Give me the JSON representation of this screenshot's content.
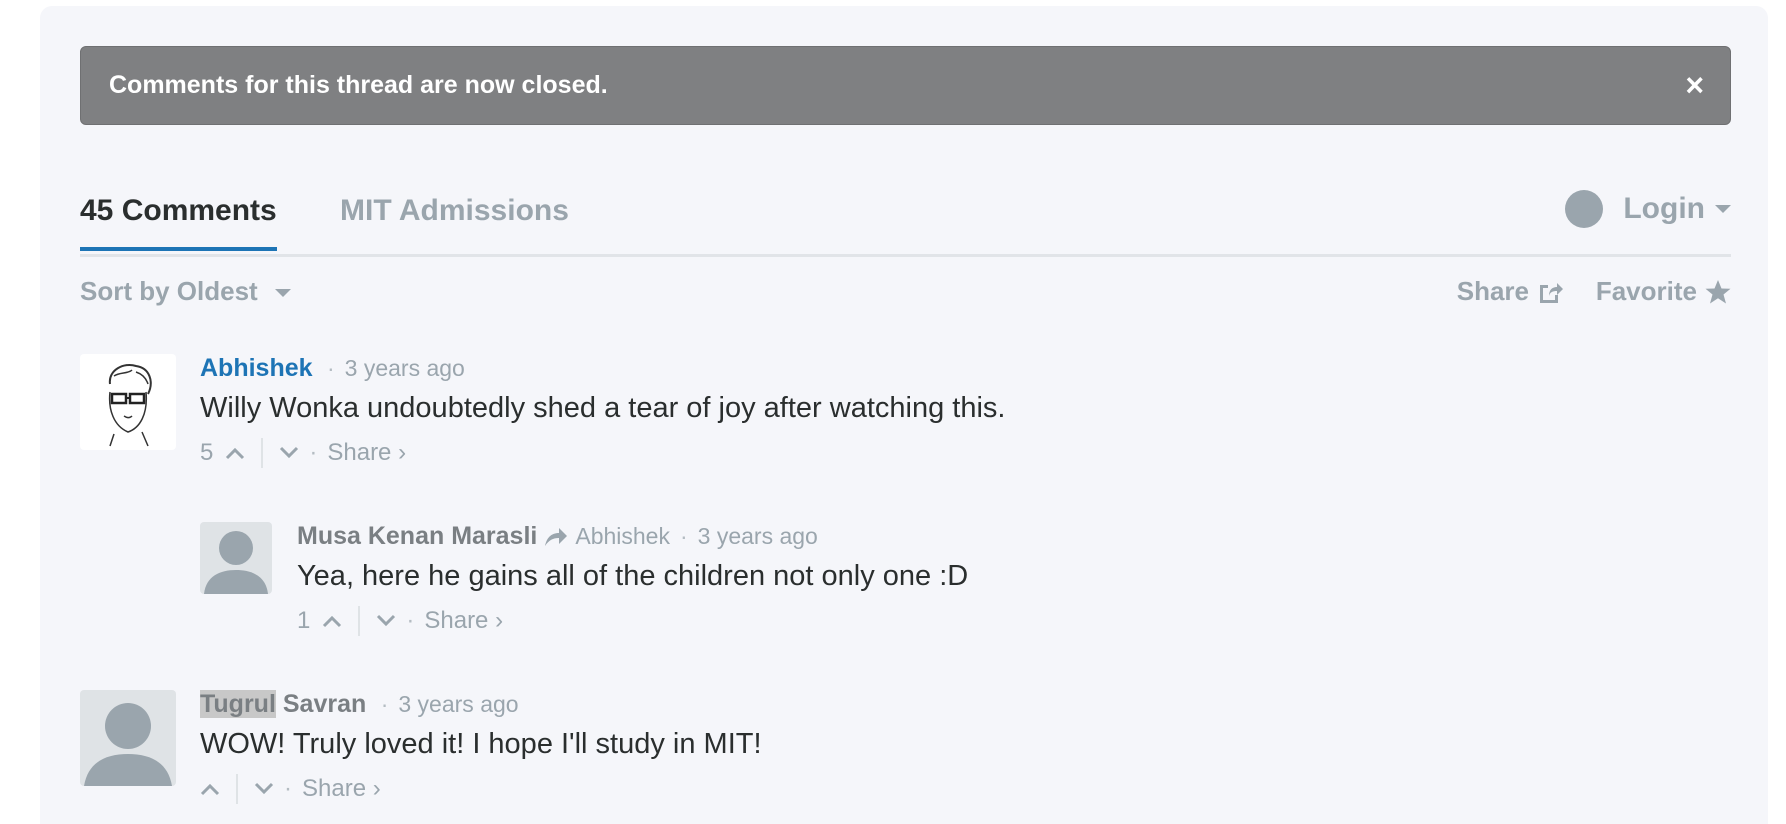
{
  "banner": {
    "text": "Comments for this thread are now closed.",
    "close": "×"
  },
  "tabs": {
    "comments": "45 Comments",
    "site": "MIT Admissions"
  },
  "login": {
    "label": "Login"
  },
  "toolbar": {
    "sort": "Sort by Oldest",
    "share": "Share",
    "favorite": "Favorite"
  },
  "comments": [
    {
      "author": "Abhishek",
      "time": "3 years ago",
      "text": "Willy Wonka undoubtedly shed a tear of joy after watching this.",
      "votes": "5",
      "share": "Share ›",
      "author_color": "#1d74b5"
    },
    {
      "author": "Musa Kenan Marasli",
      "reply_to": "Abhishek",
      "time": "3 years ago",
      "text": "Yea, here he gains all of the children not only one :D",
      "votes": "1",
      "share": "Share ›"
    },
    {
      "author_first": "Tugrul",
      "author_last": "Savran",
      "time": "3 years ago",
      "text": "WOW! Truly loved it! I hope I'll study in MIT!",
      "votes": "",
      "share": "Share ›"
    }
  ],
  "colors": {
    "accent": "#1d74b5",
    "muted": "#9aa5ad",
    "banner": "#7f8082"
  }
}
